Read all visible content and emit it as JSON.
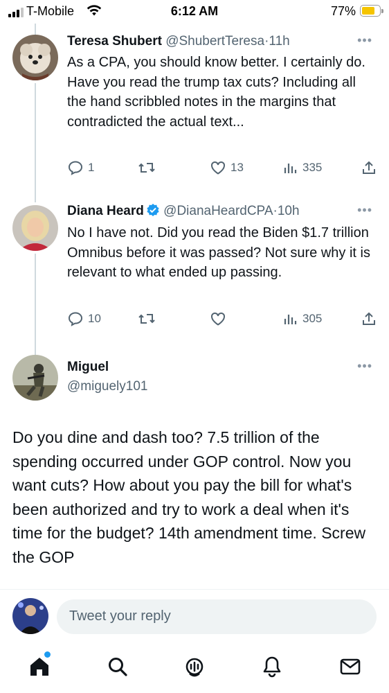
{
  "status_bar": {
    "carrier": "T-Mobile",
    "time": "6:12 AM",
    "battery_pct": "77%",
    "battery_level": 0.77
  },
  "tweets": [
    {
      "name": "Teresa Shubert",
      "handle": "@ShubertTeresa",
      "time": "11h",
      "text": "As a CPA, you should know better. I certainly do. Have you read the trump tax cuts? Including all the hand scribbled notes in the margins that contradicted the actual text...",
      "replies": "1",
      "retweets": "",
      "likes": "13",
      "views": "335",
      "avatar_icon": "dog-avatar-icon"
    },
    {
      "name": "Diana Heard",
      "handle": "@DianaHeardCPA",
      "time": "10h",
      "verified": true,
      "text": "No I have not.  Did you read the Biden $1.7 trillion Omnibus before it was passed?  Not sure why it is relevant to what ended up passing.",
      "replies": "10",
      "retweets": "",
      "likes": "",
      "views": "305",
      "avatar_icon": "woman-avatar-icon"
    }
  ],
  "main_tweet": {
    "name": "Miguel",
    "handle": "@miguely101",
    "text": "Do you dine and dash too? 7.5 trillion of the spending occurred under GOP control. Now you want cuts? How about you pay the bill for what's been authorized and try to work a deal when it's time for the budget? 14th amendment time. Screw the GOP"
  },
  "reply": {
    "placeholder": "Tweet your reply"
  },
  "tabbar": {
    "items": [
      "home-icon",
      "search-icon",
      "spaces-icon",
      "notifications-icon",
      "messages-icon"
    ],
    "home_has_dot": true
  },
  "colors": {
    "accent": "#1d9bf0",
    "text": "#0f1419",
    "muted": "#536471",
    "battery": "#f5c400"
  }
}
